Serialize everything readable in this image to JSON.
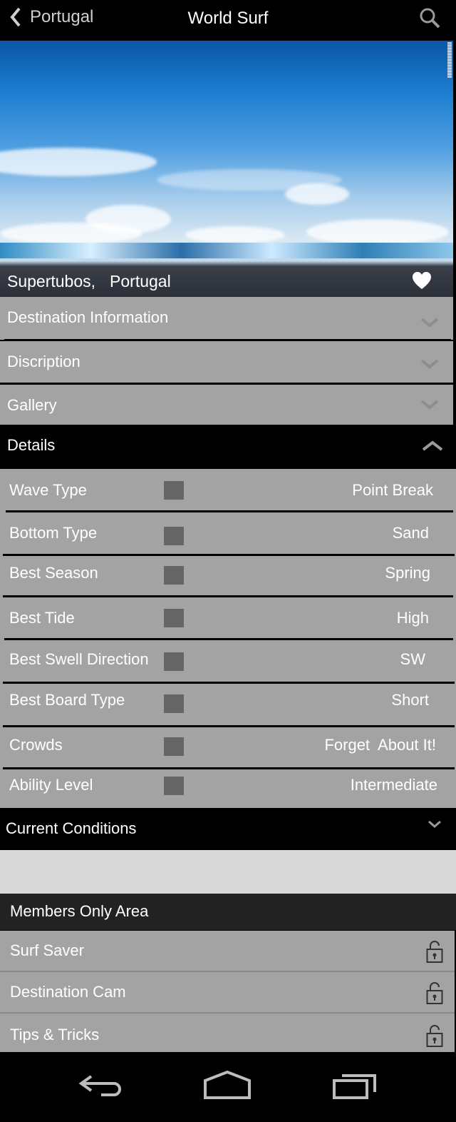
{
  "topbar": {
    "back_label": "Portugal",
    "title": "World Surf"
  },
  "hero": {
    "spot": "Supertubos,",
    "country": "Portugal",
    "favorite": true
  },
  "sections": [
    {
      "label": "Destination Information",
      "expanded": false
    },
    {
      "label": "Discription",
      "expanded": false
    },
    {
      "label": "Gallery",
      "expanded": false
    }
  ],
  "details": {
    "label": "Details",
    "expanded": true,
    "rows": [
      {
        "key": "Wave Type",
        "value": "Point Break"
      },
      {
        "key": "Bottom Type",
        "value": "Sand"
      },
      {
        "key": "Best Season",
        "value": "Spring"
      },
      {
        "key": "Best Tide",
        "value": "High"
      },
      {
        "key": "Best Swell Direction",
        "value": "SW"
      },
      {
        "key": "Best Board Type",
        "value": "Short"
      },
      {
        "key": "Crowds",
        "value": "Forget  About It!"
      },
      {
        "key": "Ability Level",
        "value": "Intermediate"
      }
    ]
  },
  "current_conditions": {
    "label": "Current Conditions",
    "expanded": false
  },
  "members": {
    "label": "Members Only Area",
    "items": [
      {
        "label": "Surf Saver",
        "locked": true
      },
      {
        "label": "Destination Cam",
        "locked": true
      },
      {
        "label": "Tips & Tricks",
        "locked": true
      }
    ]
  },
  "icons": {
    "back": "chevron-left-icon",
    "search": "search-icon",
    "favorite": "heart-icon",
    "expand": "chevron-down-icon",
    "collapse": "chevron-up-icon",
    "lock": "lock-icon",
    "nav_back": "back-arrow-icon",
    "nav_home": "home-icon",
    "nav_recents": "recents-icon"
  },
  "colors": {
    "topbar": "#000000",
    "panel": "#a3a3a3",
    "value_square": "#666666",
    "conditions_panel": "#d9d9d9",
    "members_bar": "#222222"
  }
}
